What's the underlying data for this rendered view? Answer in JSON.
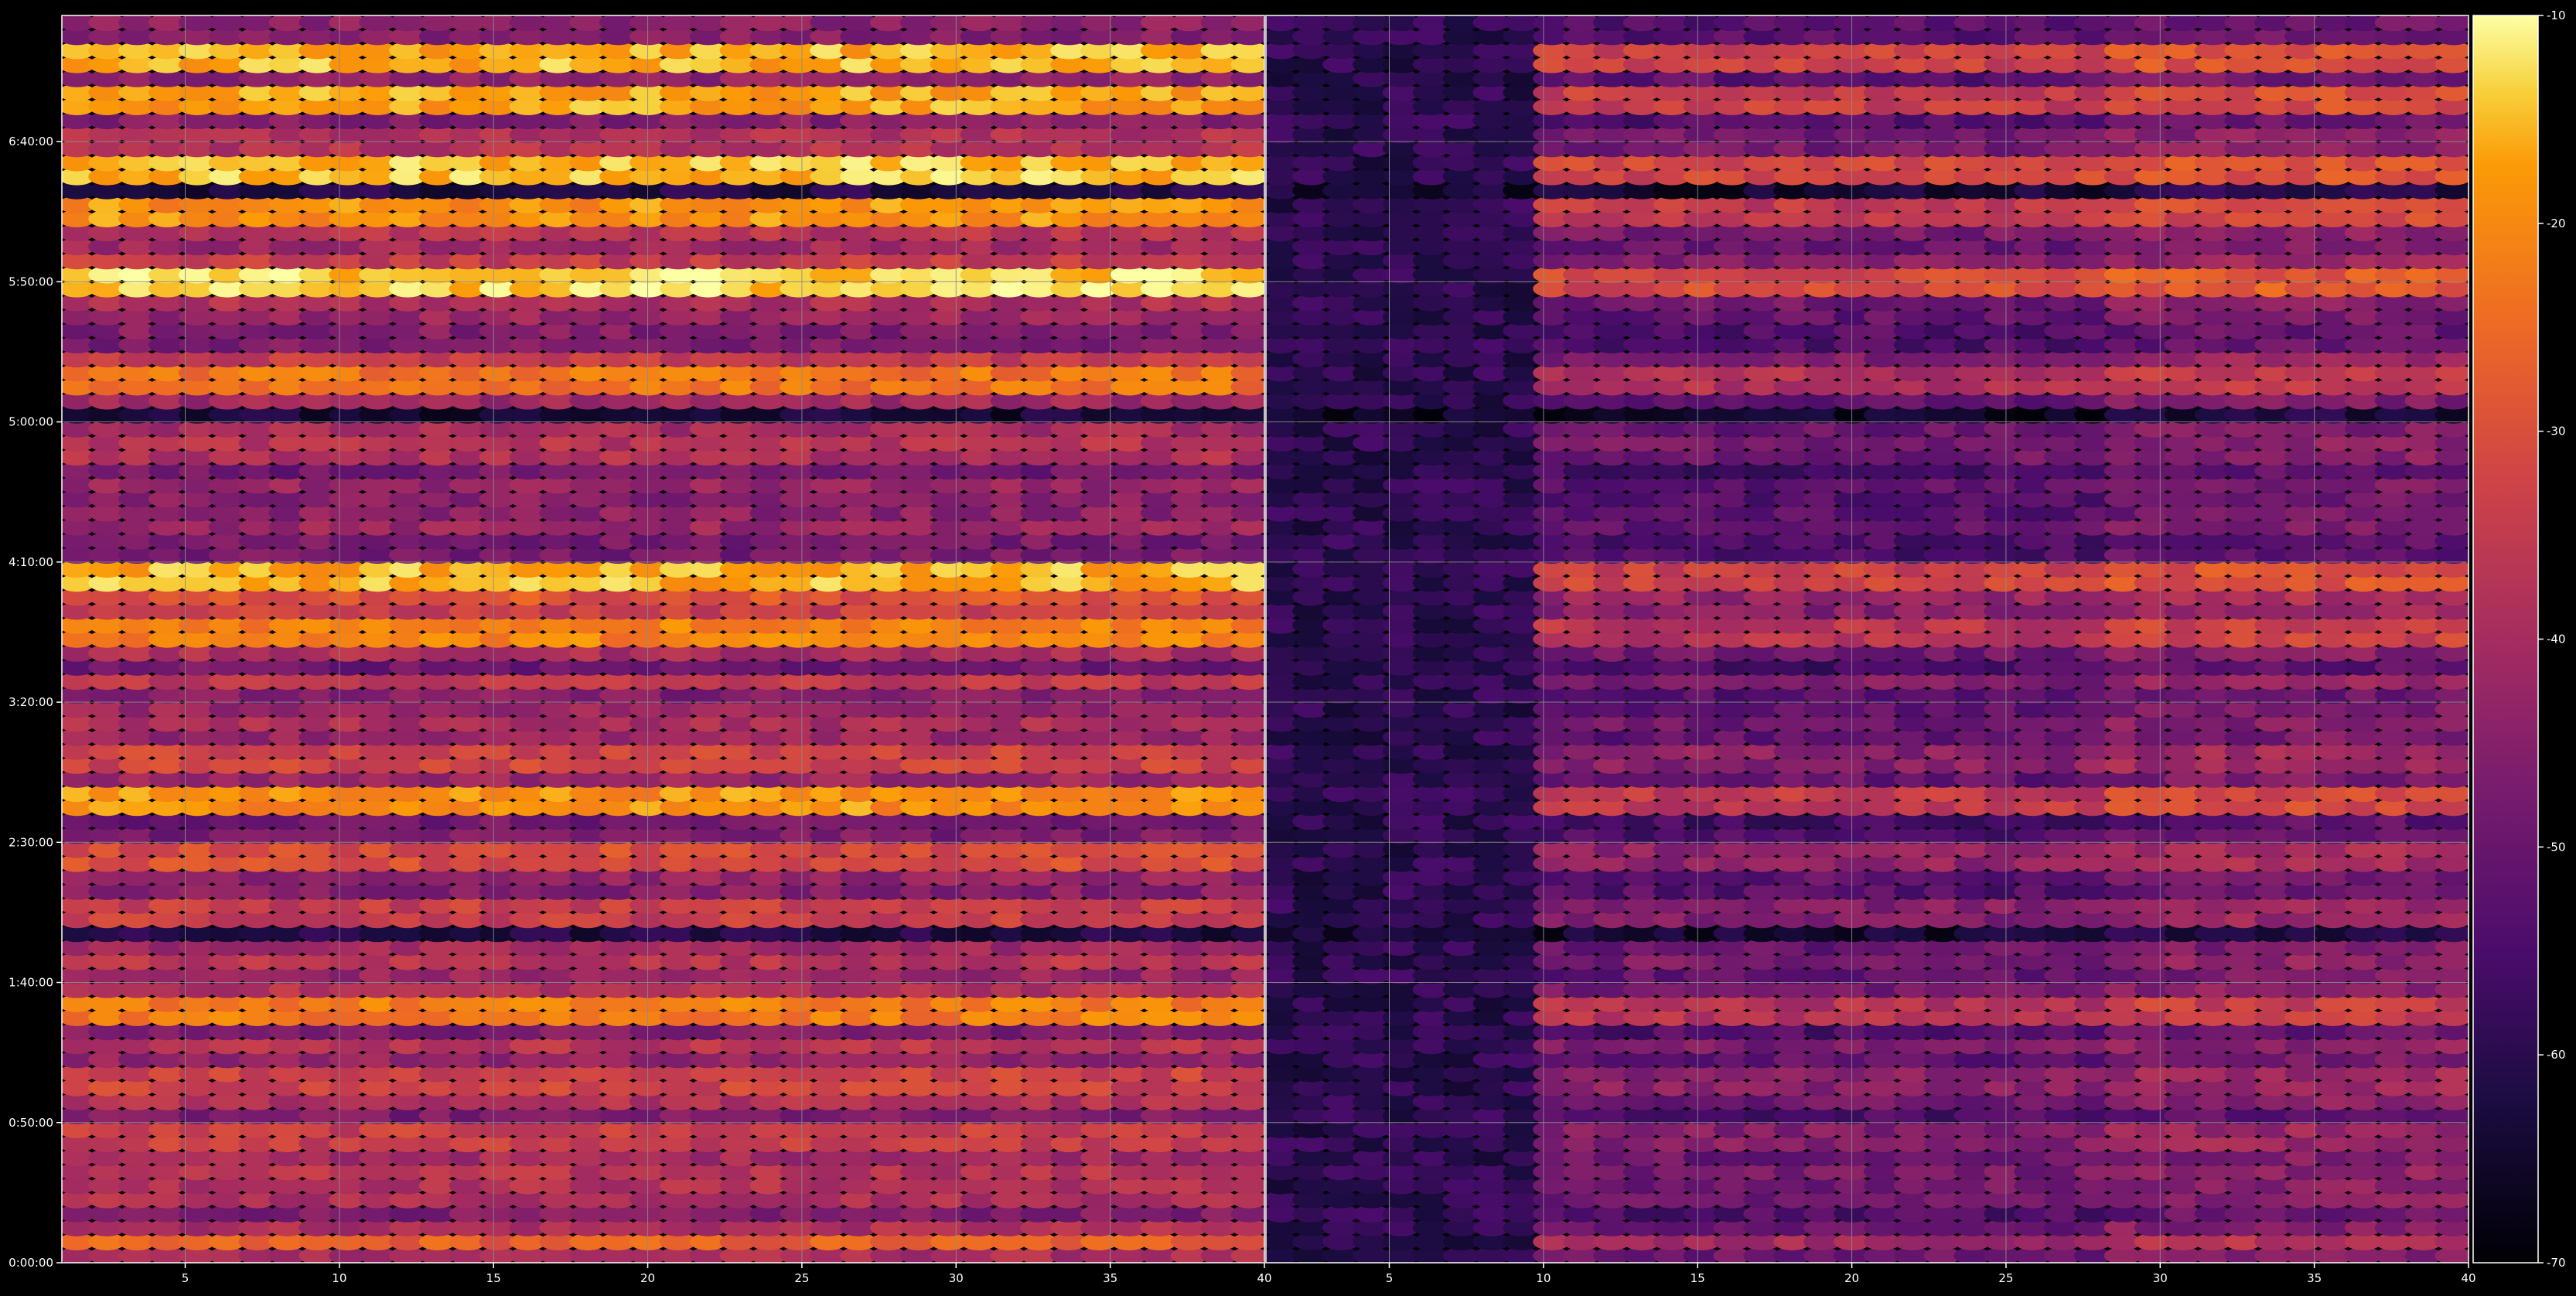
{
  "chart_data": {
    "type": "heatmap",
    "title": "",
    "xlabel": "",
    "ylabel": "",
    "colormap": "inferno",
    "background": "#000000",
    "grid": true,
    "grid_color": "#8c8c8c",
    "panels": [
      {
        "name": "",
        "x_ticks": [
          "5",
          "10",
          "15",
          "20",
          "25",
          "30",
          "35",
          "40"
        ],
        "x_tick_values": [
          5,
          10,
          15,
          20,
          25,
          30,
          35,
          40
        ],
        "xlim": [
          1,
          40
        ]
      },
      {
        "name": "",
        "x_ticks": [
          "5",
          "10",
          "15",
          "20",
          "25",
          "30",
          "35",
          "40"
        ],
        "x_tick_values": [
          5,
          10,
          15,
          20,
          25,
          30,
          35,
          40
        ],
        "xlim": [
          1,
          40
        ]
      }
    ],
    "y_ticks": [
      "0:00:00",
      "0:50:00",
      "1:40:00",
      "2:30:00",
      "3:20:00",
      "4:10:00",
      "5:00:00",
      "5:50:00",
      "6:40:00"
    ],
    "y_tick_seconds": [
      0,
      3000,
      6000,
      9000,
      12000,
      15000,
      18000,
      21000,
      24000
    ],
    "ylim_seconds": [
      0,
      26700
    ],
    "row_count": 89,
    "colorbar": {
      "ticks": [
        "-10",
        "-20",
        "-30",
        "-40",
        "-50",
        "-60",
        "-70"
      ],
      "tick_values": [
        -10,
        -20,
        -30,
        -40,
        -50,
        -60,
        -70
      ],
      "range": [
        -70,
        -10
      ]
    },
    "bright_bands": [
      {
        "time": "0:09:00",
        "level": 0.72
      },
      {
        "time": "0:45:00",
        "level": 0.6
      },
      {
        "time": "1:05:00",
        "level": 0.62
      },
      {
        "time": "1:30:00",
        "level": 0.8
      },
      {
        "time": "2:05:00",
        "level": 0.6
      },
      {
        "time": "2:25:00",
        "level": 0.65
      },
      {
        "time": "2:45:00",
        "level": 0.85
      },
      {
        "time": "3:00:00",
        "level": 0.62
      },
      {
        "time": "3:45:00",
        "level": 0.82
      },
      {
        "time": "4:00:00",
        "level": 0.68
      },
      {
        "time": "4:05:00",
        "level": 0.9
      },
      {
        "time": "5:15:00",
        "level": 0.78
      },
      {
        "time": "5:50:00",
        "level": 0.95
      },
      {
        "time": "6:15:00",
        "level": 0.85
      },
      {
        "time": "6:30:00",
        "level": 0.92
      },
      {
        "time": "6:55:00",
        "level": 0.88
      },
      {
        "time": "7:10:00",
        "level": 0.9
      }
    ],
    "panel_brightness": [
      1.0,
      0.68
    ],
    "dark_region_right_panel": {
      "x_range": [
        1,
        10
      ],
      "level": 0.1
    }
  }
}
